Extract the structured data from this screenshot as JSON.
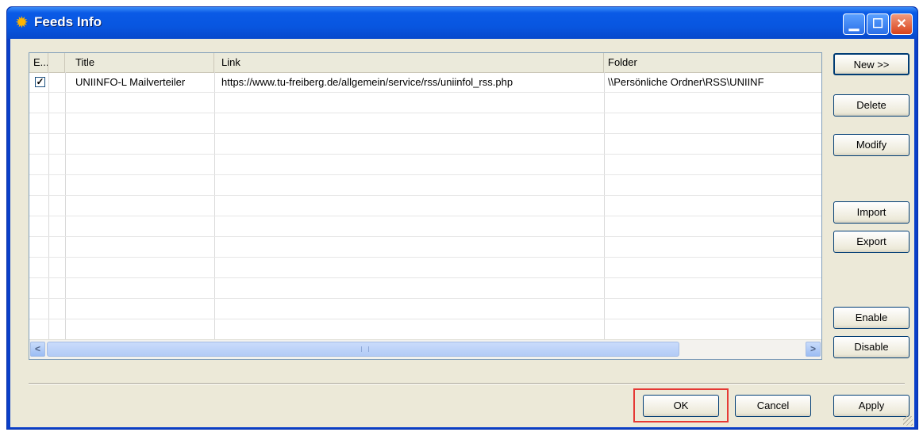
{
  "window": {
    "title": "Feeds Info"
  },
  "icons": {
    "app": "sun-icon",
    "minimize": "minimize-icon",
    "maximize": "maximize-icon",
    "close": "close-icon"
  },
  "table": {
    "columns": [
      "E...",
      "",
      "Title",
      "Link",
      "Folder"
    ],
    "rows": [
      {
        "enabled": true,
        "title": "UNIINFO-L Mailverteiler",
        "link": "https://www.tu-freiberg.de/allgemein/service/rss/uniinfol_rss.php",
        "folder": "\\\\Persönliche Ordner\\RSS\\UNIINF"
      }
    ]
  },
  "side_buttons": {
    "new": "New >>",
    "delete": "Delete",
    "modify": "Modify",
    "import": "Import",
    "export": "Export",
    "enable": "Enable",
    "disable": "Disable"
  },
  "footer_buttons": {
    "ok": "OK",
    "cancel": "Cancel",
    "apply": "Apply"
  },
  "scrollbar": {
    "left_arrow": "<",
    "right_arrow": ">"
  },
  "colors": {
    "titlebar": "#0856e0",
    "dialog_bg": "#ece9d8",
    "highlight_box": "#e53935"
  }
}
